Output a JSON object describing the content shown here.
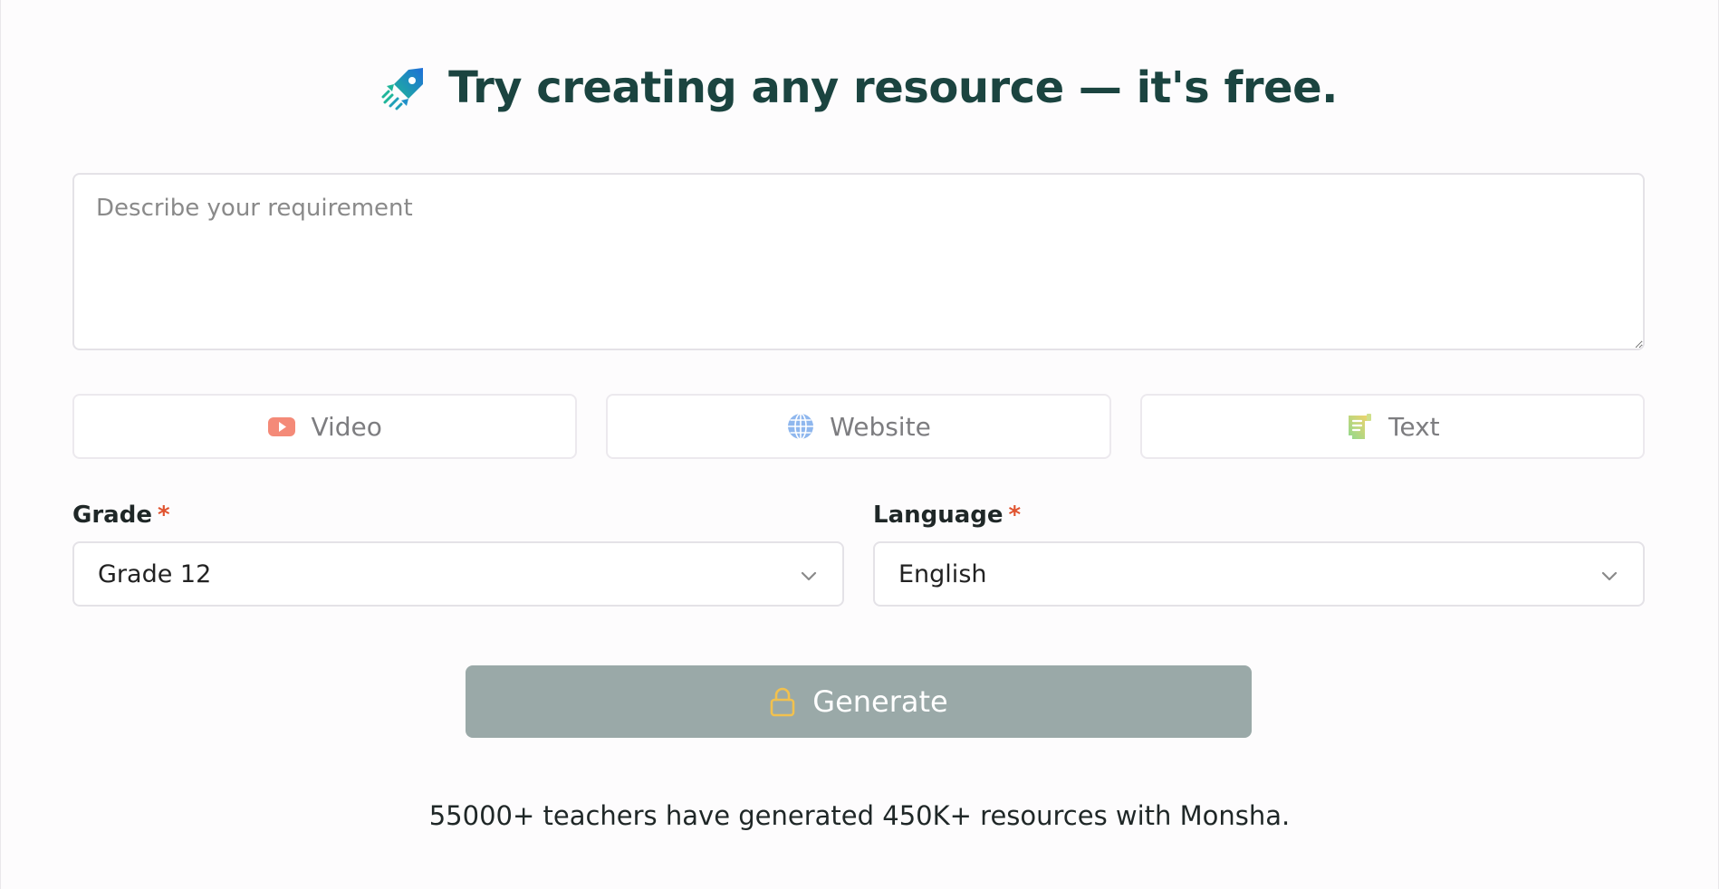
{
  "header": {
    "title": "Try creating any resource — it's free.",
    "icon": "rocket-icon"
  },
  "requirement": {
    "placeholder": "Describe your requirement",
    "value": ""
  },
  "sources": [
    {
      "label": "Video",
      "icon": "youtube-icon"
    },
    {
      "label": "Website",
      "icon": "globe-icon"
    },
    {
      "label": "Text",
      "icon": "document-icon"
    }
  ],
  "grade": {
    "label": "Grade",
    "required_mark": "*",
    "selected": "Grade 12"
  },
  "language": {
    "label": "Language",
    "required_mark": "*",
    "selected": "English"
  },
  "generate": {
    "label": "Generate",
    "icon": "lock-icon"
  },
  "footer": {
    "text": "55000+ teachers have generated 450K+ resources with Monsha."
  },
  "colors": {
    "title": "#1b4440",
    "generate_bg": "#9aa9a8",
    "required_star": "#e0532f",
    "lock": "#f2c14e"
  }
}
